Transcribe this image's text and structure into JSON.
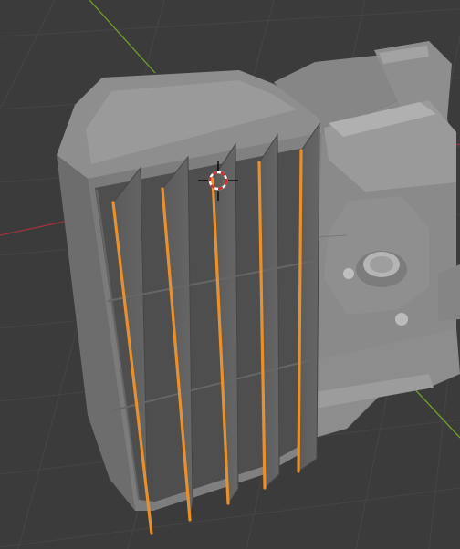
{
  "viewport": {
    "background_color": "#3b3b3b",
    "grid_color": "#444444",
    "x_axis_color": "#a0333c",
    "y_axis_color": "#6f9e2b",
    "selection_color": "#e8902e"
  },
  "scene": {
    "objects": [
      {
        "name": "louvered-panel",
        "selected": false
      },
      {
        "name": "machinery-block",
        "selected": false
      }
    ],
    "selected_edges": {
      "count": 5,
      "role": "louver-blade-edges"
    }
  },
  "cursor_3d": {
    "icon": "3d-cursor-icon"
  }
}
